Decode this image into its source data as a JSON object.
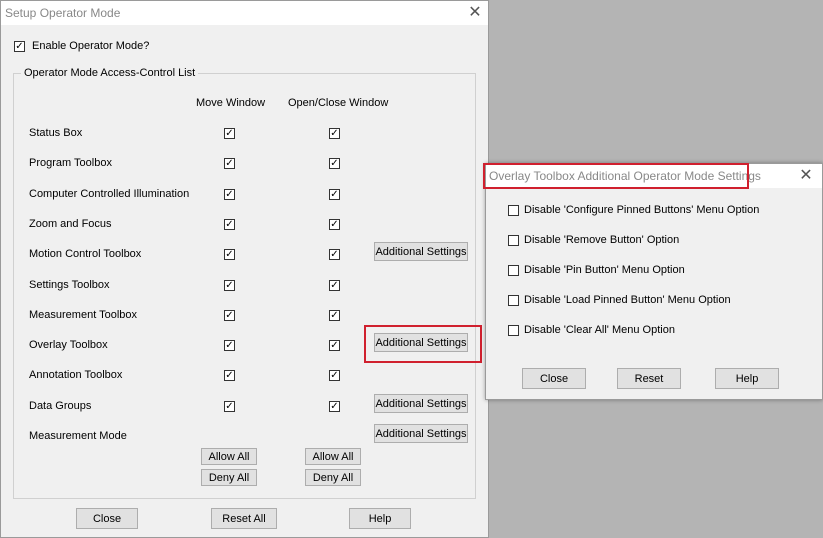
{
  "main": {
    "title": "Setup Operator Mode",
    "close_glyph": "✕",
    "enable_label": "Enable Operator Mode?",
    "group_label": "Operator Mode Access-Control List",
    "col_move": "Move Window",
    "col_open": "Open/Close Window",
    "check_glyph": "✓",
    "rows": [
      {
        "label": "Status Box",
        "move": true,
        "open": true
      },
      {
        "label": "Program Toolbox",
        "move": true,
        "open": true
      },
      {
        "label": "Computer Controlled Illumination",
        "move": true,
        "open": true
      },
      {
        "label": "Zoom and Focus",
        "move": true,
        "open": true
      },
      {
        "label": "Motion Control Toolbox",
        "move": true,
        "open": true,
        "settings": "Additional Settings"
      },
      {
        "label": "Settings Toolbox",
        "move": true,
        "open": true
      },
      {
        "label": "Measurement Toolbox",
        "move": true,
        "open": true
      },
      {
        "label": "Overlay Toolbox",
        "move": true,
        "open": true,
        "settings": "Additional Settings"
      },
      {
        "label": "Annotation Toolbox",
        "move": true,
        "open": true
      },
      {
        "label": "Data Groups",
        "move": true,
        "open": true,
        "settings": "Additional Settings"
      },
      {
        "label": "Measurement Mode",
        "settings": "Additional Settings"
      }
    ],
    "allow_all": "Allow All",
    "deny_all": "Deny All",
    "close_btn": "Close",
    "reset_all_btn": "Reset All",
    "help_btn": "Help"
  },
  "overlay": {
    "title": "Overlay Toolbox Additional Operator Mode Settings",
    "close_glyph": "✕",
    "options": [
      "Disable 'Configure Pinned Buttons' Menu Option",
      "Disable 'Remove Button' Option",
      "Disable 'Pin Button' Menu Option",
      "Disable 'Load Pinned Button' Menu Option",
      "Disable 'Clear All' Menu Option"
    ],
    "close_btn": "Close",
    "reset_btn": "Reset",
    "help_btn": "Help"
  },
  "colors": {
    "highlight": "#d0202e",
    "dialog_bg": "#f0f0f0",
    "desktop": "#b4b4b4"
  }
}
